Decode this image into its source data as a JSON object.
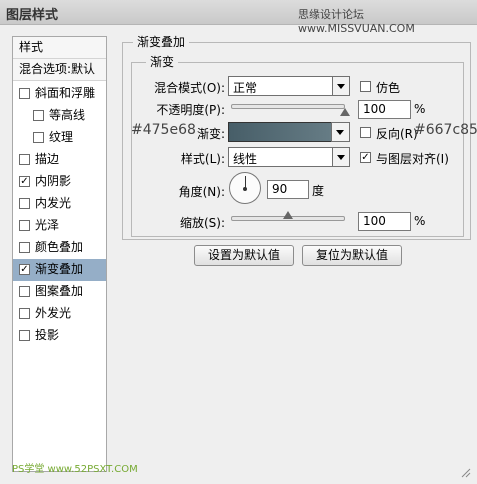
{
  "window": {
    "title": "图层样式",
    "watermark_top": "思缘设计论坛 www.MISSVUAN.COM"
  },
  "left_panel": {
    "items": [
      {
        "label": "样式",
        "type": "header"
      },
      {
        "label": "混合选项:默认",
        "type": "header"
      },
      {
        "label": "斜面和浮雕",
        "checked": false
      },
      {
        "label": "等高线",
        "checked": false,
        "indent": true
      },
      {
        "label": "纹理",
        "checked": false,
        "indent": true
      },
      {
        "label": "描边",
        "checked": false
      },
      {
        "label": "内阴影",
        "checked": true
      },
      {
        "label": "内发光",
        "checked": false
      },
      {
        "label": "光泽",
        "checked": false
      },
      {
        "label": "颜色叠加",
        "checked": false
      },
      {
        "label": "渐变叠加",
        "checked": true,
        "selected": true
      },
      {
        "label": "图案叠加",
        "checked": false
      },
      {
        "label": "外发光",
        "checked": false
      },
      {
        "label": "投影",
        "checked": false
      }
    ]
  },
  "panel": {
    "outer_title": "渐变叠加",
    "inner_title": "渐变",
    "blend_mode": {
      "label": "混合模式(O):",
      "value": "正常"
    },
    "dither": {
      "label": "仿色",
      "checked": false
    },
    "opacity": {
      "label": "不透明度(P):",
      "value": "100",
      "unit": "%",
      "level": 1.0
    },
    "gradient": {
      "label": "渐变:",
      "start_color": "#475e68",
      "end_color": "#667c85"
    },
    "reverse": {
      "label": "反向(R)",
      "checked": false
    },
    "style": {
      "label": "样式(L):",
      "value": "线性"
    },
    "align": {
      "label": "与图层对齐(I)",
      "checked": true
    },
    "angle": {
      "label": "角度(N):",
      "value": "90",
      "unit": "度"
    },
    "scale": {
      "label": "缩放(S):",
      "value": "100",
      "unit": "%",
      "level": 0.5
    },
    "buttons": {
      "set_default": "设置为默认值",
      "reset_default": "复位为默认值"
    }
  },
  "annotations": {
    "left_color": "#475e68",
    "right_color": "#667c85"
  },
  "footer": {
    "watermark": "PS学堂 www.52PSXT.COM"
  }
}
